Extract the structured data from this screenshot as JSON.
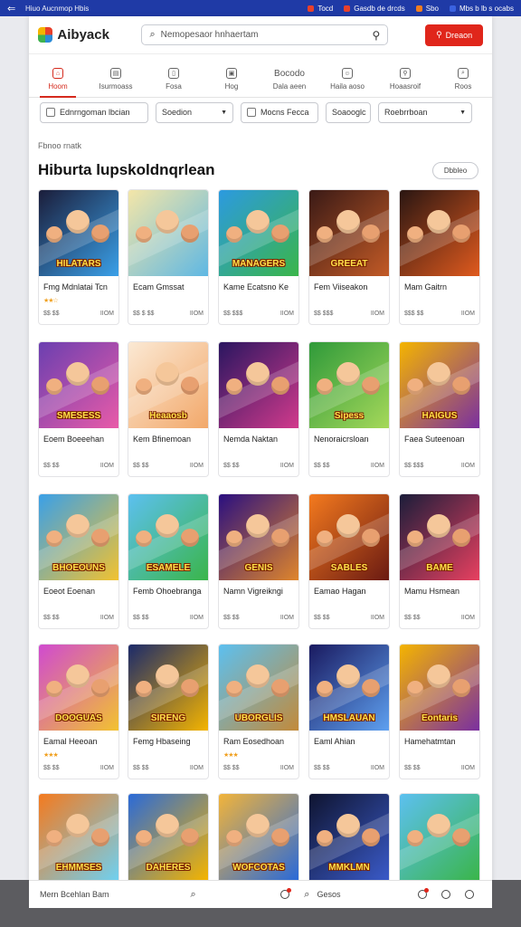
{
  "topbar": {
    "title": "Hiuo Aucnmop Hbis",
    "items": [
      {
        "label": "Tocd",
        "color": "#e8402b"
      },
      {
        "label": "Gasdb de drcds",
        "color": "#e8402b"
      },
      {
        "label": "Sbo",
        "color": "#f07d20"
      },
      {
        "label": "Mbs b lb s ocabs",
        "color": "#3a62e0"
      }
    ]
  },
  "header": {
    "logo": "Aibyack",
    "search_placeholder": "Nemopesaor hnhaertam",
    "primary_button": "Dreaon"
  },
  "nav": [
    {
      "label": "Hoom",
      "glyph": "⌂",
      "active": true
    },
    {
      "label": "Isurmoass",
      "glyph": "▤",
      "active": false
    },
    {
      "label": "Fosa",
      "glyph": "▯",
      "active": false
    },
    {
      "label": "Hog",
      "glyph": "▣",
      "active": false
    },
    {
      "label": "Dala aeen",
      "glyph": "Bocodo",
      "active": false
    },
    {
      "label": "Haila aoso",
      "glyph": "☺",
      "active": false
    },
    {
      "label": "Hoaasroif",
      "glyph": "⚲",
      "active": false
    },
    {
      "label": "Roos",
      "glyph": "⌕",
      "active": false
    }
  ],
  "filters": [
    {
      "label": "Ednrngoman lbcian",
      "icon": true,
      "caret": false,
      "width": 120
    },
    {
      "label": "Soedion",
      "icon": false,
      "caret": true,
      "width": 86
    },
    {
      "label": "Mocns Fecca",
      "icon": true,
      "caret": false,
      "width": 86
    },
    {
      "label": "Soaooglc",
      "icon": false,
      "caret": false,
      "width": 50
    },
    {
      "label": "Roebrrboan",
      "icon": false,
      "caret": true,
      "width": 104
    }
  ],
  "section": {
    "kicker": "Fbnoo rnatk",
    "title": "Hiburta lupskoldnqrlean",
    "view_all": "Dbbleo"
  },
  "cards": [
    {
      "name": "Fmg Mdnlatai Tcn",
      "stars": "★★☆",
      "meta1": "$$ $$",
      "meta2": "IIOM",
      "colors": [
        "#1b1d3a",
        "#3aa0e8"
      ],
      "banner": "HILATARS"
    },
    {
      "name": "Ecam Gmssat",
      "stars": "",
      "meta1": "$$ $ $$",
      "meta2": "IIOM",
      "colors": [
        "#f4e6a8",
        "#5fb8e3"
      ],
      "banner": ""
    },
    {
      "name": "Kame Ecatsno Ke",
      "stars": "",
      "meta1": "$$ $$$",
      "meta2": "IIOM",
      "colors": [
        "#2c9ae0",
        "#3ab54a"
      ],
      "banner": "MANAGERS"
    },
    {
      "name": "Fem Viiseakon",
      "stars": "",
      "meta1": "$$ $$$",
      "meta2": "IIOM",
      "colors": [
        "#3a1a16",
        "#c25a26"
      ],
      "banner": "GREEAT"
    },
    {
      "name": "Mam Gaitrn",
      "stars": "",
      "meta1": "$$$ $$",
      "meta2": "IIOM",
      "colors": [
        "#2a1612",
        "#e05a1e"
      ],
      "banner": ""
    },
    {
      "name": "Eoem Boeeehan",
      "stars": "",
      "meta1": "$$ $$",
      "meta2": "IIOM",
      "colors": [
        "#6b3fb0",
        "#e85ba8"
      ],
      "banner": "SMESESS"
    },
    {
      "name": "Kem Bfinemoan",
      "stars": "",
      "meta1": "$$ $$",
      "meta2": "IIOM",
      "colors": [
        "#fbe9d4",
        "#f2a86a"
      ],
      "banner": "Heaaosb"
    },
    {
      "name": "Nemda Naktan",
      "stars": "",
      "meta1": "$$ $$",
      "meta2": "IIOM",
      "colors": [
        "#2a1660",
        "#d13a8c"
      ],
      "banner": ""
    },
    {
      "name": "Nenoraicrsloan",
      "stars": "",
      "meta1": "$$ $$",
      "meta2": "IIOM",
      "colors": [
        "#2f9a3a",
        "#a5d85a"
      ],
      "banner": "Sipess"
    },
    {
      "name": "Faea Suteenoan",
      "stars": "",
      "meta1": "$$ $$$",
      "meta2": "IIOM",
      "colors": [
        "#f4b400",
        "#7a2fa0"
      ],
      "banner": "HAIGUS"
    },
    {
      "name": "Eoeot Eoenan",
      "stars": "",
      "meta1": "$$ $$",
      "meta2": "IIOM",
      "colors": [
        "#3aa0e8",
        "#f2c230"
      ],
      "banner": "BHOEOUNS"
    },
    {
      "name": "Femb Ohoebranga",
      "stars": "",
      "meta1": "$$ $$",
      "meta2": "IIOM",
      "colors": [
        "#5cc0f0",
        "#3ab54a"
      ],
      "banner": "ESAMELE"
    },
    {
      "name": "Namn Vigreikngi",
      "stars": "",
      "meta1": "$$ $$",
      "meta2": "IIOM",
      "colors": [
        "#2a0f80",
        "#e0862b"
      ],
      "banner": "GENIS"
    },
    {
      "name": "Eamao Hagan",
      "stars": "",
      "meta1": "$$ $$",
      "meta2": "IIOM",
      "colors": [
        "#f47a1e",
        "#6a1a12"
      ],
      "banner": "SABLES"
    },
    {
      "name": "Mamu Hsmean",
      "stars": "",
      "meta1": "$$ $$",
      "meta2": "IIOM",
      "colors": [
        "#1b1d3a",
        "#e84060"
      ],
      "banner": "BAME"
    },
    {
      "name": "Eamal Heeoan",
      "stars": "★★★",
      "meta1": "$$ $$",
      "meta2": "IIOM",
      "colors": [
        "#d04ad0",
        "#f2c230"
      ],
      "banner": "DOOGUAS"
    },
    {
      "name": "Femg Hbaseing",
      "stars": "",
      "meta1": "$$ $$",
      "meta2": "IIOM",
      "colors": [
        "#1b2a6a",
        "#f4b400"
      ],
      "banner": "SIRENG"
    },
    {
      "name": "Ram Eosedhoan",
      "stars": "★★★",
      "meta1": "$$ $$",
      "meta2": "IIOM",
      "colors": [
        "#5cc0f0",
        "#c28a3a"
      ],
      "banner": "UBORGLIS"
    },
    {
      "name": "Eaml Ahian",
      "stars": "",
      "meta1": "$$ $$",
      "meta2": "IIOM",
      "colors": [
        "#1a1a60",
        "#5ea0f0"
      ],
      "banner": "HMSLAUAN"
    },
    {
      "name": "Hamehatmtan",
      "stars": "",
      "meta1": "$$ $$",
      "meta2": "IIOM",
      "colors": [
        "#f4b400",
        "#7a2fa0"
      ],
      "banner": "Eontaris"
    },
    {
      "name": "",
      "stars": "",
      "meta1": "",
      "meta2": "",
      "colors": [
        "#f47a1e",
        "#6fd0f0"
      ],
      "banner": "EHMMSES"
    },
    {
      "name": "",
      "stars": "",
      "meta1": "",
      "meta2": "",
      "colors": [
        "#2a6ad8",
        "#f4b400"
      ],
      "banner": "DAHERES"
    },
    {
      "name": "",
      "stars": "",
      "meta1": "",
      "meta2": "",
      "colors": [
        "#f2b43a",
        "#2a6ad8"
      ],
      "banner": "WOFCOTAS"
    },
    {
      "name": "",
      "stars": "",
      "meta1": "",
      "meta2": "",
      "colors": [
        "#0f1430",
        "#3a5ac8"
      ],
      "banner": "MMKLMN"
    },
    {
      "name": "",
      "stars": "",
      "meta1": "",
      "meta2": "",
      "colors": [
        "#5cc0f0",
        "#3ab54a"
      ],
      "banner": ""
    }
  ],
  "bottom": {
    "left_text": "Mern Bcehlan Bam",
    "center_text": "Gesos"
  }
}
